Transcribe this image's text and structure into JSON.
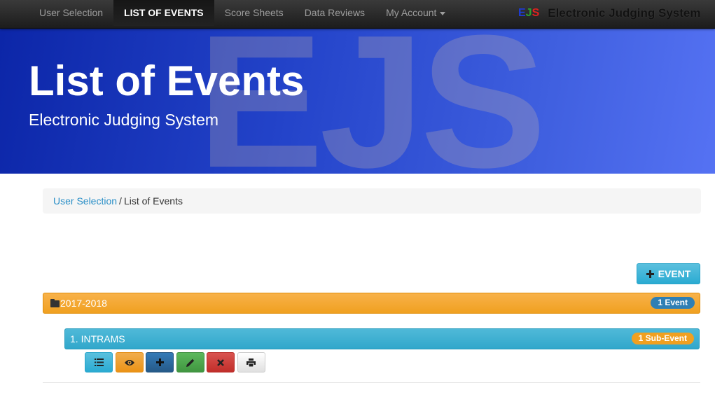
{
  "navbar": {
    "items": [
      {
        "label": "User Selection",
        "active": false
      },
      {
        "label": "LIST OF EVENTS",
        "active": true
      },
      {
        "label": "Score Sheets",
        "active": false
      },
      {
        "label": "Data Reviews",
        "active": false
      },
      {
        "label": "My Account",
        "active": false,
        "dropdown": true
      }
    ],
    "brand": {
      "logo_e": "E",
      "logo_j": "J",
      "logo_s": "S",
      "title": "Electronic Judging System"
    }
  },
  "hero": {
    "watermark": "EJS",
    "title": "List of Events",
    "subtitle": "Electronic Judging System"
  },
  "breadcrumb": {
    "link": "User Selection",
    "separator": "/",
    "current": "List of Events"
  },
  "add_event_button": {
    "label": "EVENT",
    "icon": "plus-icon"
  },
  "year_group": {
    "label": "2017-2018",
    "icon": "folder-icon",
    "badge": "1 Event"
  },
  "event": {
    "label": "1. INTRAMS",
    "badge": "1 Sub-Event",
    "actions": [
      {
        "name": "list-icon",
        "color": "#5bc0de"
      },
      {
        "name": "eye-icon",
        "color": "#f0ad4e"
      },
      {
        "name": "plus-icon",
        "color": "#337ab7"
      },
      {
        "name": "pencil-icon",
        "color": "#5cb85c"
      },
      {
        "name": "remove-icon",
        "color": "#d9534f"
      },
      {
        "name": "print-icon",
        "color": "#ffffff"
      }
    ]
  },
  "colors": {
    "accent_blue": "#5bc0de",
    "accent_orange": "#f0a020",
    "hero_blue": "#2343c9",
    "link": "#2a8fc7"
  }
}
